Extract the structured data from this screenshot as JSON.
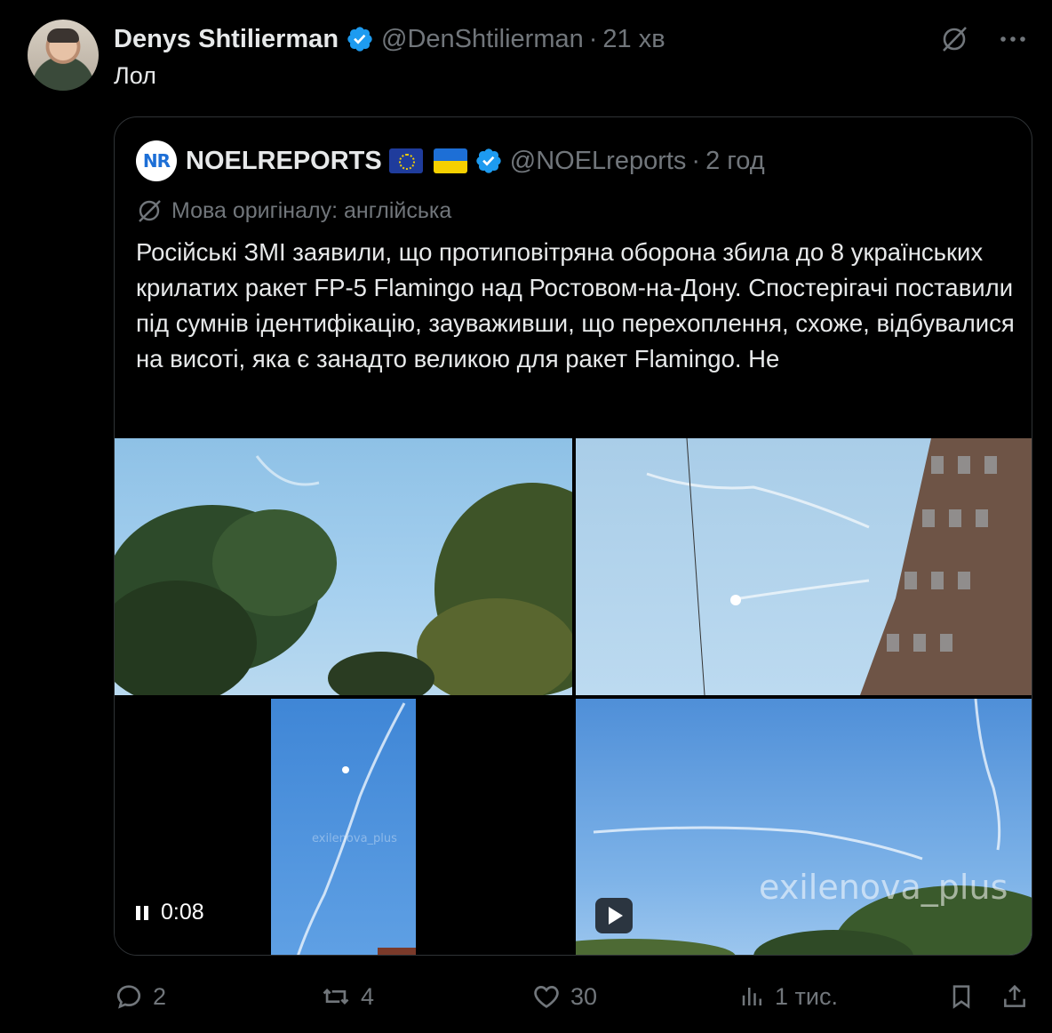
{
  "post": {
    "author_name": "Denys Shtilierman",
    "handle": "@DenShtilierman",
    "separator": "·",
    "time": "21 хв",
    "text": "Лол"
  },
  "icons": {
    "avatar": "avatar",
    "verified": "verified-badge-icon",
    "grok": "grok-icon",
    "more": "more-icon"
  },
  "quote": {
    "logo_text": "NR",
    "author_name": "NOELREPORTS",
    "handle": "@NOELreports",
    "separator": "·",
    "time": "2 год",
    "translate_label": "Мова оригіналу: англійська",
    "text": "Російські ЗМІ заявили, що протиповітряна оборона збила до 8 українських крилатих ракет FP-5 Flamingo над Ростовом-на-Дону. Спостерігачі поставили під сумнів ідентифікацію, зауваживши, що перехоплення, схоже, відбувалися на висоті, яка є занадто великою для ракет Flamingo. Не"
  },
  "media": {
    "video_time": "0:08",
    "watermark_small": "exilenova_plus",
    "watermark_big": "exilenova_plus"
  },
  "actions": {
    "replies": "2",
    "reposts": "4",
    "likes": "30",
    "views": "1 тис."
  },
  "colors": {
    "background": "#000000",
    "text": "#e7e9ea",
    "secondary": "#71767b",
    "border": "#2f3336",
    "verified": "#1d9bf0"
  }
}
